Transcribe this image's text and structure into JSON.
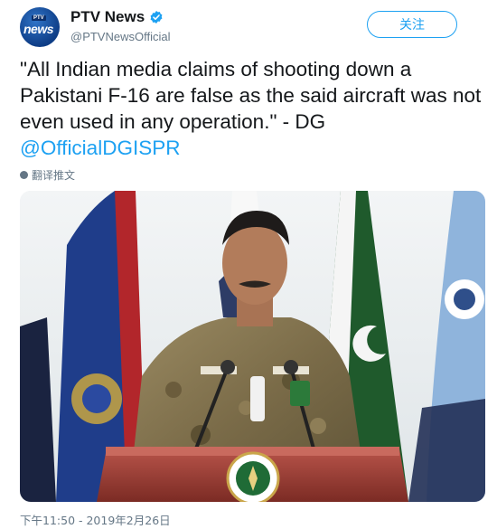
{
  "account": {
    "display_name": "PTV News",
    "handle": "@PTVNewsOfficial",
    "verified": true,
    "avatar_text_top": "PTV",
    "avatar_text_main": "news"
  },
  "follow_button": {
    "label": "关注"
  },
  "tweet": {
    "text_main": "\"All Indian media claims of shooting down a Pakistani F-16 are false as the said aircraft was not even used in any operation.\" - DG ",
    "mention": "@OfficialDGISPR"
  },
  "translate_link": {
    "label": "翻译推文",
    "icon": "globe-icon"
  },
  "timestamp": "下午11:50 - 2019年2月26日",
  "colors": {
    "link_blue": "#1da1f2",
    "secondary_gray": "#657786",
    "text": "#14171a"
  }
}
